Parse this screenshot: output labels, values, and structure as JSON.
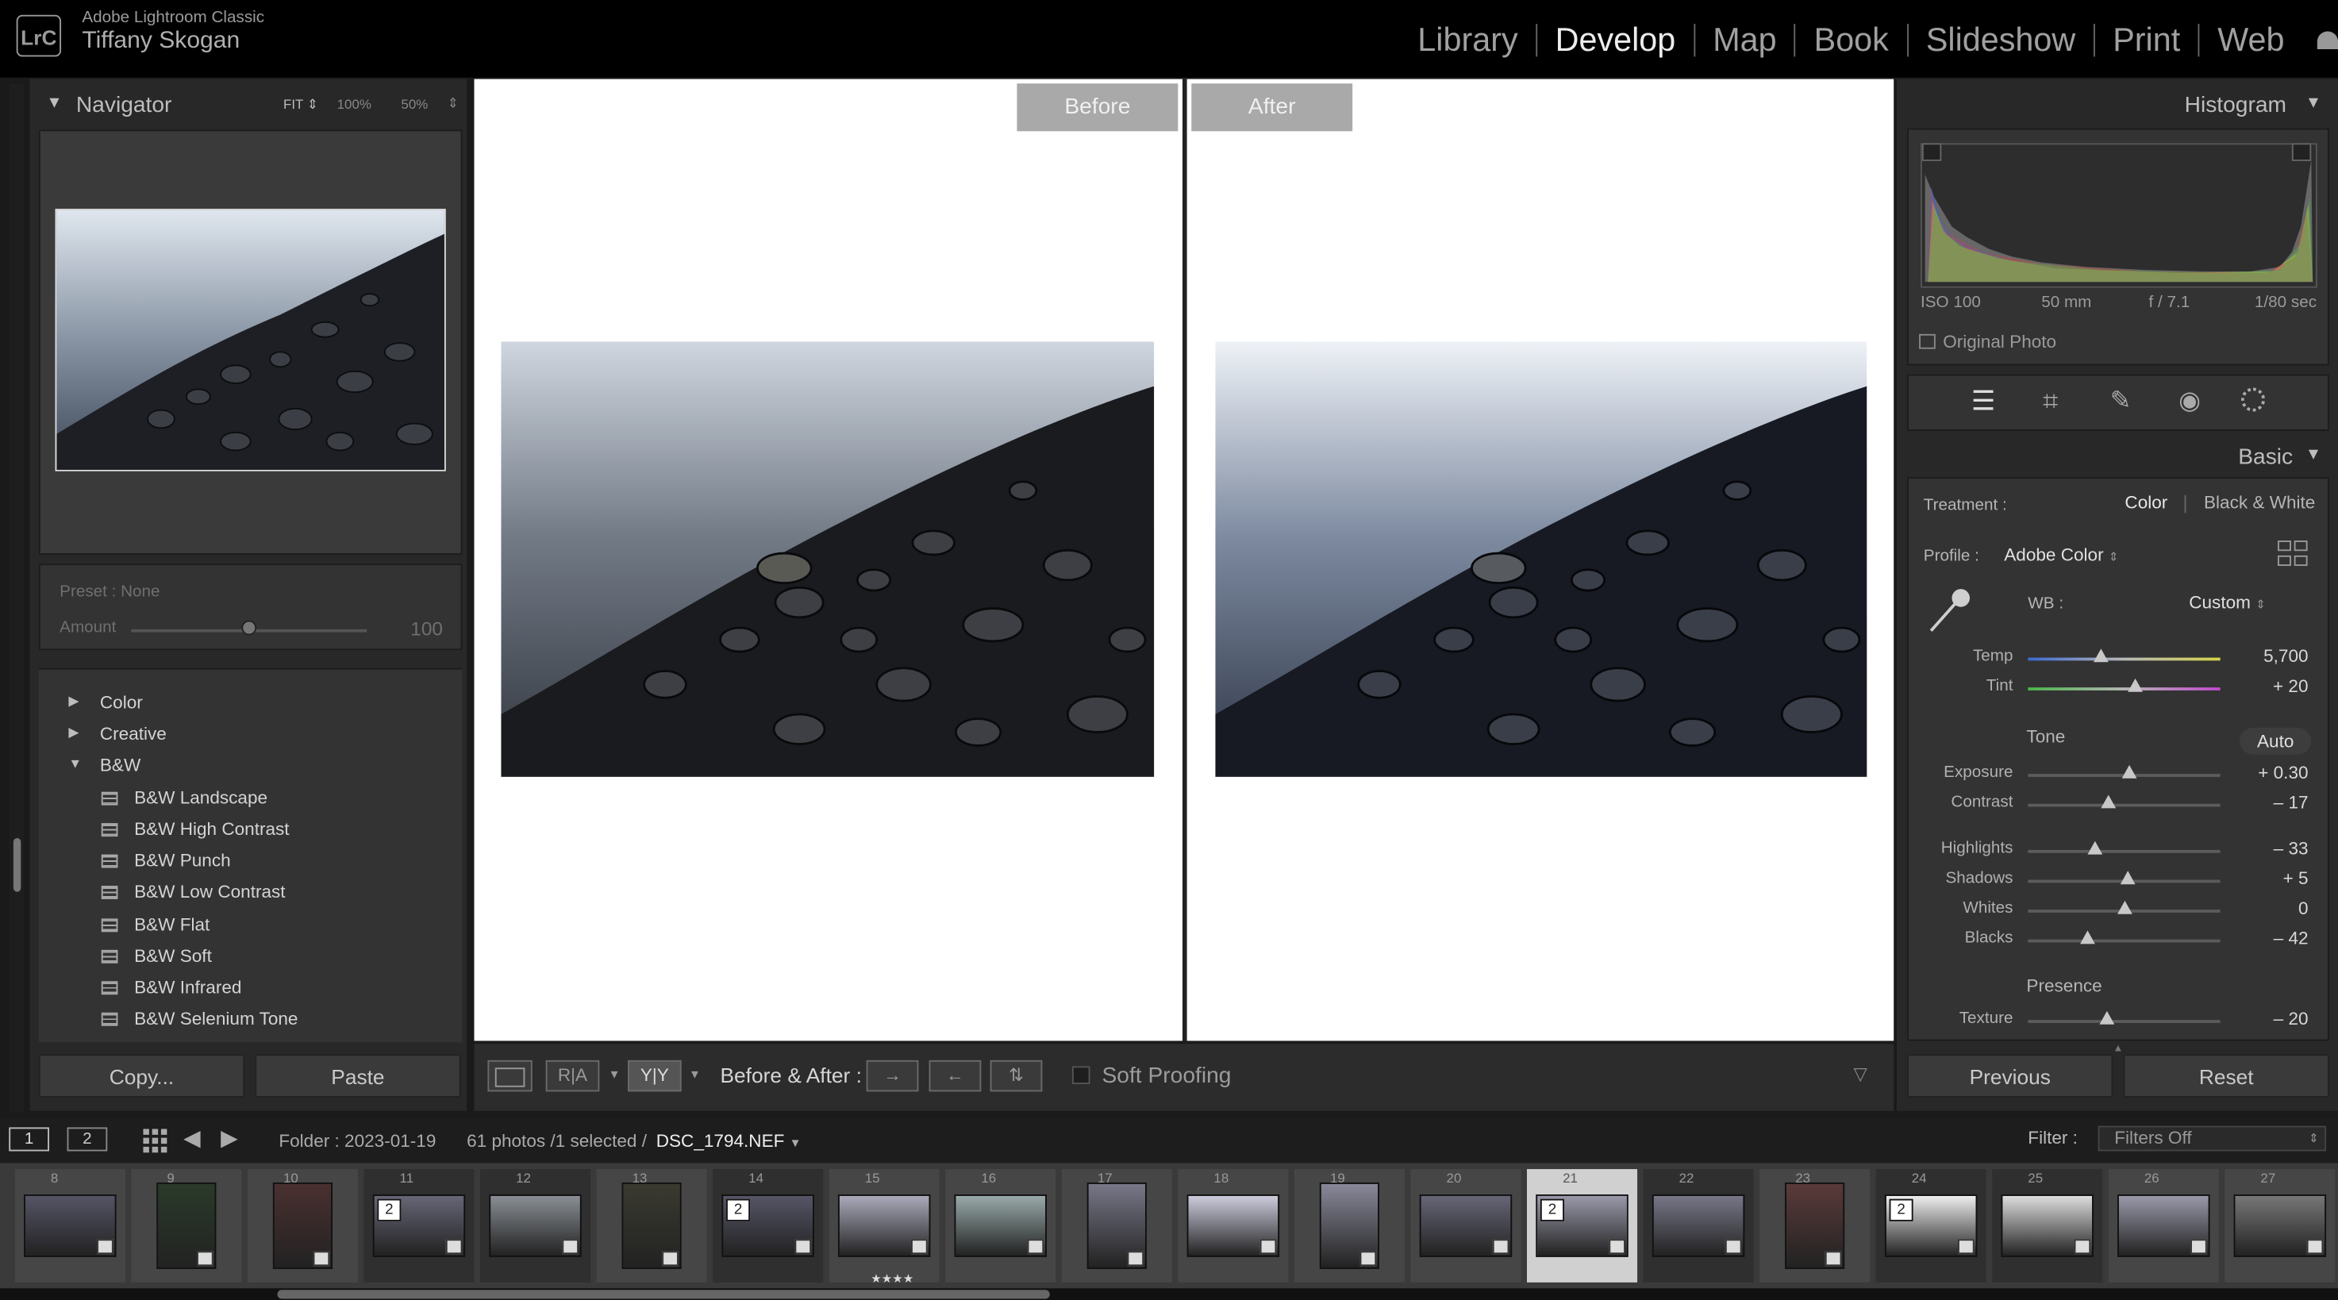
{
  "app": {
    "logo": "LrC",
    "name": "Adobe Lightroom Classic",
    "user": "Tiffany Skogan"
  },
  "modules": [
    "Library",
    "Develop",
    "Map",
    "Book",
    "Slideshow",
    "Print",
    "Web"
  ],
  "active_module": "Develop",
  "navigator": {
    "title": "Navigator",
    "zoom_fit": "FIT",
    "zoom_100": "100%",
    "zoom_50": "50%",
    "preset_label": "Preset : None",
    "amount_label": "Amount",
    "amount_value": "100",
    "amount_fraction": 0.5
  },
  "presets": {
    "groups": [
      "Color",
      "Creative",
      "B&W"
    ],
    "bw_items": [
      "B&W Landscape",
      "B&W High Contrast",
      "B&W Punch",
      "B&W Low Contrast",
      "B&W Flat",
      "B&W Soft",
      "B&W Infrared",
      "B&W Selenium Tone"
    ]
  },
  "left_buttons": {
    "copy": "Copy...",
    "paste": "Paste"
  },
  "compare": {
    "before": "Before",
    "after": "After"
  },
  "toolbar": {
    "ba_label": "Before & After :",
    "view_ra": "R|A",
    "view_yy": "Y|Y",
    "soft_proofing": "Soft Proofing"
  },
  "histogram": {
    "title": "Histogram",
    "iso": "ISO 100",
    "focal": "50 mm",
    "aperture": "f / 7.1",
    "shutter": "1/80 sec",
    "original_photo": "Original Photo"
  },
  "basic": {
    "title": "Basic",
    "treatment_label": "Treatment :",
    "treatment_color": "Color",
    "treatment_bw": "Black & White",
    "profile_label": "Profile :",
    "profile_value": "Adobe Color",
    "wb_label": "WB :",
    "wb_value": "Custom",
    "tone_label": "Tone",
    "auto": "Auto",
    "presence_label": "Presence",
    "sliders": [
      {
        "label": "Temp",
        "value": "5,700",
        "pos": 0.38
      },
      {
        "label": "Tint",
        "value": "+ 20",
        "pos": 0.56
      },
      {
        "label": "Exposure",
        "value": "+ 0.30",
        "pos": 0.53
      },
      {
        "label": "Contrast",
        "value": "– 17",
        "pos": 0.42
      },
      {
        "label": "Highlights",
        "value": "– 33",
        "pos": 0.35
      },
      {
        "label": "Shadows",
        "value": "+ 5",
        "pos": 0.52
      },
      {
        "label": "Whites",
        "value": "0",
        "pos": 0.5
      },
      {
        "label": "Blacks",
        "value": "– 42",
        "pos": 0.31
      },
      {
        "label": "Texture",
        "value": "– 20",
        "pos": 0.41
      }
    ]
  },
  "right_buttons": {
    "previous": "Previous",
    "reset": "Reset"
  },
  "filmstrip_bar": {
    "screen1": "1",
    "screen2": "2",
    "folder": "Folder : 2023-01-19",
    "count": "61 photos /1 selected /",
    "filename": "DSC_1794.NEF",
    "filter_label": "Filter :",
    "filter_value": "Filters Off"
  },
  "filmstrip": {
    "numbers": [
      "8",
      "9",
      "10",
      "11",
      "12",
      "13",
      "14",
      "15",
      "16",
      "17",
      "18",
      "19",
      "20",
      "21",
      "22",
      "23",
      "24",
      "25",
      "26",
      "27"
    ],
    "stack_badge": "2",
    "stars": "★★★★"
  }
}
